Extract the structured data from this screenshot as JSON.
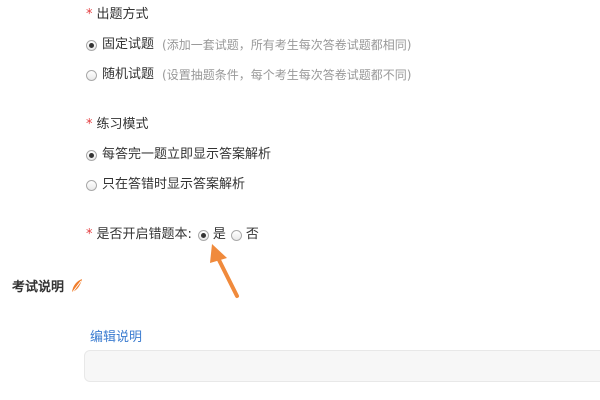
{
  "question_mode": {
    "label": "出题方式",
    "options": [
      {
        "label": "固定试题",
        "hint": "(添加一套试题，所有考生每次答卷试题都相同)",
        "checked": true
      },
      {
        "label": "随机试题",
        "hint": "(设置抽题条件，每个考生每次答卷试题都不同)",
        "checked": false
      }
    ]
  },
  "practice_mode": {
    "label": "练习模式",
    "options": [
      {
        "label": "每答完一题立即显示答案解析",
        "checked": true
      },
      {
        "label": "只在答错时显示答案解析",
        "checked": false
      }
    ]
  },
  "wrong_book": {
    "label": "是否开启错题本:",
    "yes_label": "是",
    "no_label": "否",
    "selected": "是"
  },
  "exam_notes": {
    "title": "考试说明",
    "edit_link": "编辑说明"
  },
  "colors": {
    "required_star": "#e4393c",
    "link": "#3b7cd0",
    "hint": "#999999",
    "arrow": "#f08a3c",
    "feather": "#f07c2a"
  }
}
